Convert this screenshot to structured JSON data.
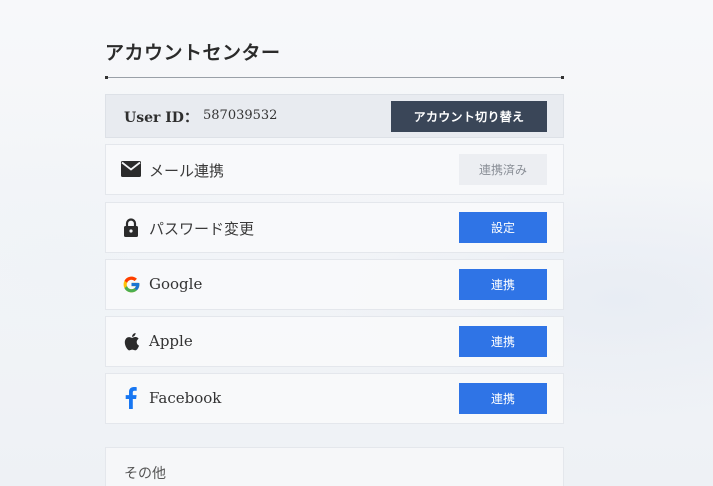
{
  "page": {
    "title": "アカウントセンター"
  },
  "user": {
    "id_label": "User ID：",
    "id_value": "587039532",
    "switch_button": "アカウント切り替え"
  },
  "rows": [
    {
      "key": "mail",
      "icon": "mail-icon",
      "label": "メール連携",
      "button": "連携済み",
      "state": "linked"
    },
    {
      "key": "password",
      "icon": "lock-icon",
      "label": "パスワード変更",
      "button": "設定",
      "state": "action"
    },
    {
      "key": "google",
      "icon": "google-icon",
      "label": "Google",
      "button": "連携",
      "state": "action"
    },
    {
      "key": "apple",
      "icon": "apple-icon",
      "label": "Apple",
      "button": "連携",
      "state": "action"
    },
    {
      "key": "facebook",
      "icon": "facebook-icon",
      "label": "Facebook",
      "button": "連携",
      "state": "action"
    }
  ],
  "other": {
    "label": "その他"
  },
  "colors": {
    "primary_button": "#2f74e6",
    "dark_button": "#3a4658",
    "linked_button_bg": "#eceef2",
    "facebook_blue": "#1877f2"
  }
}
